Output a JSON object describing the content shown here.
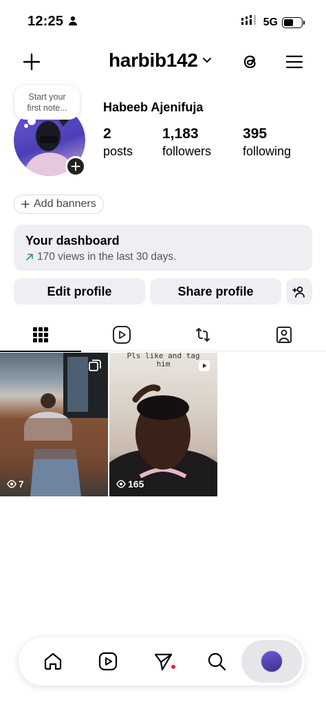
{
  "status_bar": {
    "time": "12:25",
    "network": "5G",
    "battery_level": 0.55
  },
  "header": {
    "username": "harbib142"
  },
  "note": {
    "line1": "Start your",
    "line2": "first note..."
  },
  "profile": {
    "full_name": "Habeeb Ajenifuja"
  },
  "stats": {
    "posts": {
      "count": "2",
      "label": "posts"
    },
    "followers": {
      "count": "1,183",
      "label": "followers"
    },
    "following": {
      "count": "395",
      "label": "following"
    }
  },
  "add_banners_label": "Add banners",
  "dashboard": {
    "title": "Your dashboard",
    "subtitle": "170 views in the last 30 days."
  },
  "buttons": {
    "edit": "Edit profile",
    "share": "Share profile"
  },
  "tabs": [
    "grid-icon",
    "reels-icon",
    "reposts-icon",
    "tagged-icon"
  ],
  "posts": [
    {
      "views": "7",
      "type": "carousel"
    },
    {
      "views": "165",
      "type": "reel",
      "caption_line1": "Pls like and tag",
      "caption_line2": "him"
    }
  ],
  "bottom_nav": [
    "home-icon",
    "reels-icon",
    "messages-icon",
    "search-icon",
    "profile-avatar"
  ],
  "colors": {
    "surface": "#efeff3",
    "badge_red": "#e5243b",
    "text_muted": "#555555"
  }
}
